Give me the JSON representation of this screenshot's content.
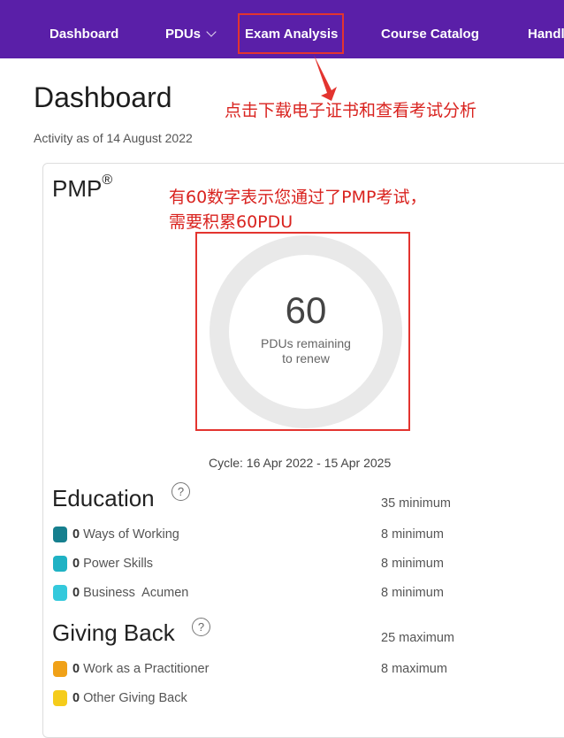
{
  "nav": {
    "items": [
      "Dashboard",
      "PDUs",
      "Exam Analysis",
      "Course Catalog",
      "Handl"
    ]
  },
  "annotations": {
    "nav_note": "点击下载电子证书和查看考试分析",
    "pdu_note_line1": "有60数字表示您通过了PMP考试，",
    "pdu_note_line2": "需要积累60PDU"
  },
  "page": {
    "title": "Dashboard",
    "activity": "Activity as of 14 August 2022"
  },
  "certification": {
    "name": "PMP",
    "mark": "®",
    "remaining": "60",
    "remaining_label_1": "PDUs remaining",
    "remaining_label_2": "to renew",
    "cycle": "Cycle: 16 Apr 2022 - 15 Apr 2025"
  },
  "education": {
    "title": "Education",
    "help": "?",
    "requirement": "35 minimum",
    "rows": [
      {
        "count": "0",
        "label": "Ways of Working",
        "requirement": "8 minimum",
        "color": "#167f8e"
      },
      {
        "count": "0",
        "label": "Power Skills",
        "requirement": "8 minimum",
        "color": "#1fb2c4"
      },
      {
        "count": "0",
        "label": "Business  Acumen",
        "requirement": "8 minimum",
        "color": "#34c9dc"
      }
    ]
  },
  "giving_back": {
    "title": "Giving Back",
    "help": "?",
    "requirement": "25 maximum",
    "rows": [
      {
        "count": "0",
        "label": "Work as a Practitioner",
        "requirement": "8 maximum",
        "color": "#f0a118"
      },
      {
        "count": "0",
        "label": "Other Giving Back",
        "requirement": "",
        "color": "#f5cc1b"
      }
    ]
  },
  "colors": {
    "nav_bg": "#5a1fa8",
    "annotation_red": "#d9231f",
    "ring_track": "#e9e9e9"
  }
}
